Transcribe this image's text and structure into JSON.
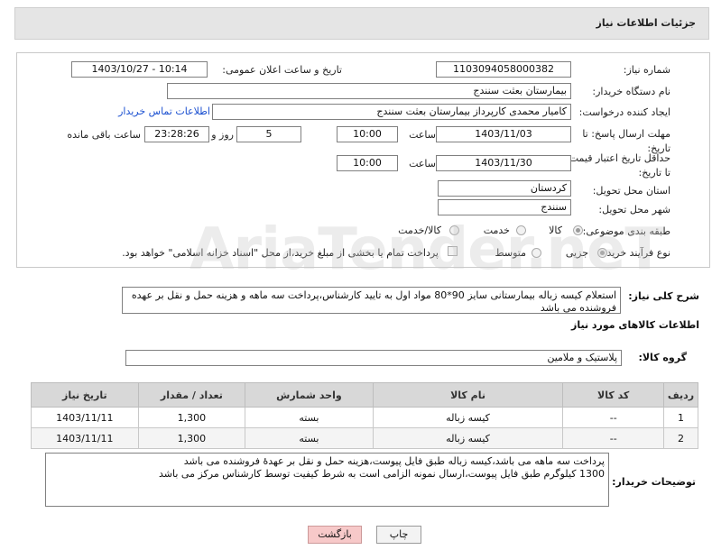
{
  "header": {
    "title": "جزئیات اطلاعات نیاز"
  },
  "form": {
    "need_number_label": "شماره نیاز:",
    "need_number": "1103094058000382",
    "announce_label": "تاریخ و ساعت اعلان عمومی:",
    "announce_value": "1403/10/27 - 10:14",
    "buyer_label": "نام دستگاه خریدار:",
    "buyer_value": "بیمارستان بعثت سنندج",
    "creator_label": "ایجاد کننده درخواست:",
    "creator_value": "کامیار محمدی کارپرداز بیمارستان بعثت سنندج",
    "contact_link": "اطلاعات تماس خریدار",
    "send_deadline_label": "مهلت ارسال پاسخ: تا تاریخ:",
    "send_date": "1403/11/03",
    "time_label": "ساعت",
    "send_time": "10:00",
    "days_value": "5",
    "days_label": "روز و",
    "remaining_time": "23:28:26",
    "remaining_label": "ساعت باقی مانده",
    "price_deadline_label": "حداقل تاریخ اعتبار قیمت: تا تاریخ:",
    "price_date": "1403/11/30",
    "price_time_label": "ساعت",
    "price_time": "10:00",
    "province_label": "استان محل تحویل:",
    "province_value": "کردستان",
    "city_label": "شهر محل تحویل:",
    "city_value": "سنندج",
    "category_label": "طبقه بندی موضوعی:",
    "category_options": [
      "کالا",
      "خدمت",
      "کالا/خدمت"
    ],
    "category_selected": "کالا",
    "purchase_label": "نوع فرآیند خرید :",
    "purchase_options": [
      "جزیی",
      "متوسط"
    ],
    "purchase_selected": "جزیی",
    "payment_note": "پرداخت تمام یا بخشی از مبلغ خرید،از محل \"اسناد خزانه اسلامی\" خواهد بود."
  },
  "general": {
    "label": "شرح کلی نیاز:",
    "text": "استعلام کیسه زباله بیمارستانی سایز 90*80 مواد اول به تایید کارشناس،پرداخت سه ماهه و هزینه حمل و نقل بر عهده فروشنده می باشد"
  },
  "goods": {
    "section_title": "اطلاعات کالاهای مورد نیاز",
    "group_label": "گروه کالا:",
    "group_value": "پلاستیک و ملامین",
    "columns": [
      "ردیف",
      "کد کالا",
      "نام کالا",
      "واحد شمارش",
      "تعداد / مقدار",
      "تاریخ نیاز"
    ],
    "rows": [
      {
        "row": "1",
        "code": "--",
        "name": "کیسه زباله",
        "unit": "بسته",
        "qty": "1,300",
        "date": "1403/11/11"
      },
      {
        "row": "2",
        "code": "--",
        "name": "کیسه زباله",
        "unit": "بسته",
        "qty": "1,300",
        "date": "1403/11/11"
      }
    ]
  },
  "buyer_notes": {
    "label": "توضیحات خریدار:",
    "text": "پرداخت سه ماهه می باشد،کیسه زباله طبق فایل پیوست،هزینه حمل و نقل بر عهدۀ فروشنده می باشد\n1300 کیلوگرم طبق فایل پیوست،ارسال نمونه الزامی است به شرط کیفیت توسط کارشناس مرکز می باشد"
  },
  "buttons": {
    "print": "چاپ",
    "back": "بازگشت"
  },
  "watermark": "AriaTender.neT"
}
